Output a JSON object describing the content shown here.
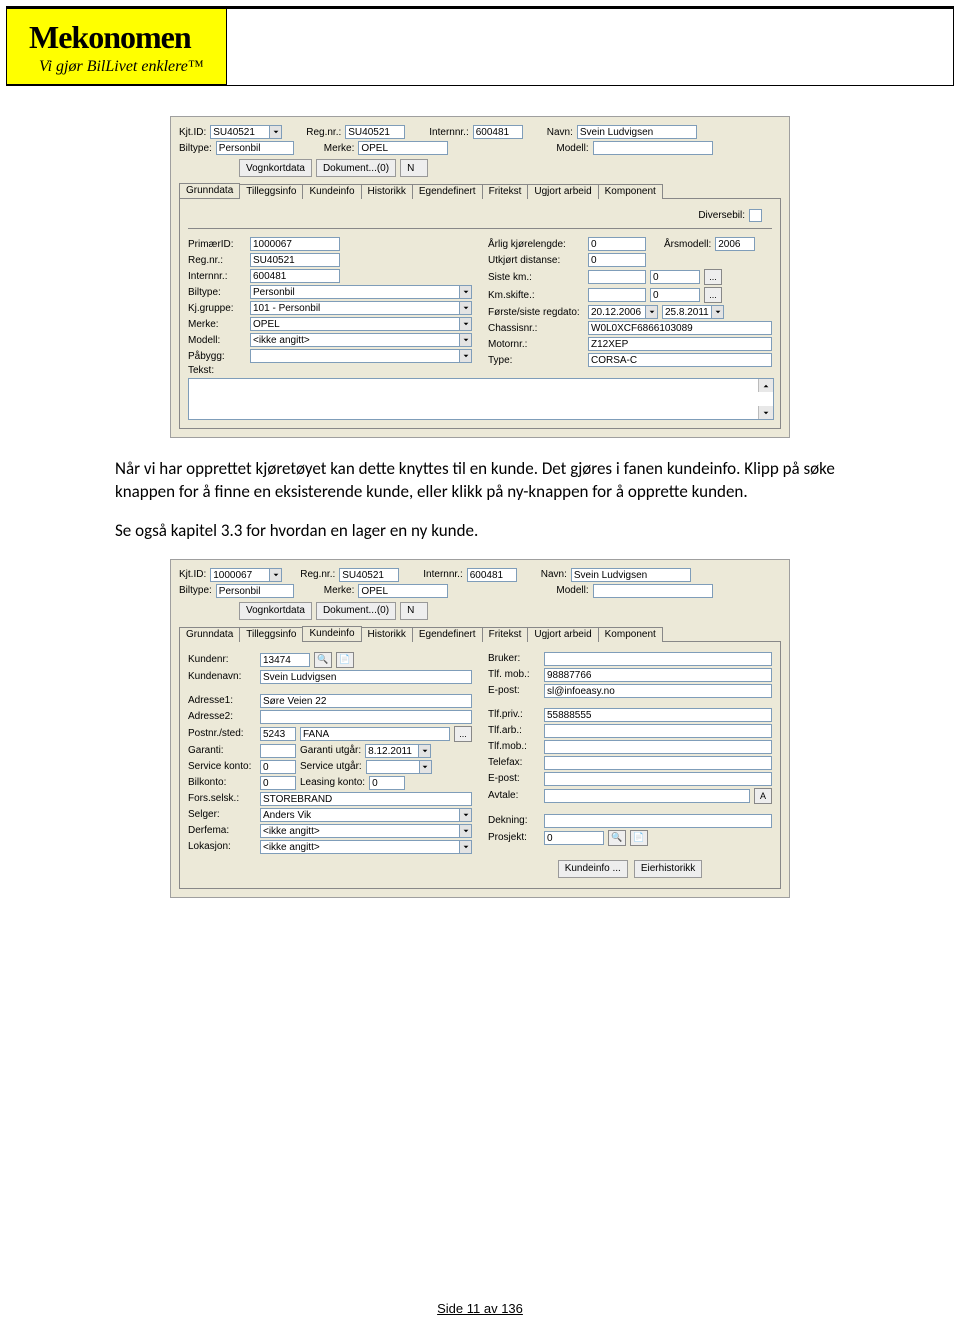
{
  "header": {
    "brand": "Mekonomen",
    "tagline": "Vi gjør BilLivet enklere™"
  },
  "screenshot1": {
    "top": {
      "kjtid_label": "Kjt.ID:",
      "kjtid": "SU40521",
      "regnr_label": "Reg.nr.:",
      "regnr": "SU40521",
      "internnr_label": "Internnr.:",
      "internnr": "600481",
      "navn_label": "Navn:",
      "navn": "Svein Ludvigsen",
      "biltype_label": "Biltype:",
      "biltype": "Personbil",
      "merke_label": "Merke:",
      "merke": "OPEL",
      "modell_label": "Modell:",
      "modell": "",
      "btn_vognkort": "Vognkortdata",
      "btn_dokument": "Dokument...(0)",
      "btn_n": "N"
    },
    "tabs": [
      "Grunndata",
      "Tilleggsinfo",
      "Kundeinfo",
      "Historikk",
      "Egendefinert",
      "Fritekst",
      "Ugjort arbeid",
      "Komponent"
    ],
    "active_tab": 0,
    "diversebil_label": "Diversebil:",
    "left": {
      "primaerid_label": "PrimærID:",
      "primaerid": "1000067",
      "regnr_label": "Reg.nr.:",
      "regnr": "SU40521",
      "internnr_label": "Internnr.:",
      "internnr": "600481",
      "biltype_label": "Biltype:",
      "biltype": "Personbil",
      "kjgruppe_label": "Kj.gruppe:",
      "kjgruppe": "101 - Personbil",
      "merke_label": "Merke:",
      "merke": "OPEL",
      "modell_label": "Modell:",
      "modell": "<ikke angitt>",
      "pabygg_label": "Påbygg:",
      "pabygg": "",
      "tekst_label": "Tekst:"
    },
    "right": {
      "arligkjl_label": "Årlig kjørelengde:",
      "arligkjl": "0",
      "arsmodell_label": "Årsmodell:",
      "arsmodell": "2006",
      "utkjort_label": "Utkjørt distanse:",
      "utkjort": "0",
      "sistekm_label": "Siste km.:",
      "sistekm_a": "",
      "sistekm_b": "0",
      "kmskifte_label": "Km.skifte.:",
      "kmskifte_a": "",
      "kmskifte_b": "0",
      "regdato_label": "Første/siste regdato:",
      "regdato_a": "20.12.2006",
      "regdato_b": "25.8.2011",
      "chassis_label": "Chassisnr.:",
      "chassis": "W0L0XCF6866103089",
      "motornr_label": "Motornr.:",
      "motornr": "Z12XEP",
      "type_label": "Type:",
      "type": "CORSA-C"
    }
  },
  "body": {
    "p1": "Når vi har opprettet kjøretøyet kan dette knyttes til en kunde. Det gjøres i fanen kundeinfo. Klipp på søke knappen for å finne en eksisterende kunde, eller klikk på ny-knappen for å opprette kunden.",
    "p2": "Se også kapitel 3.3 for hvordan en lager en ny kunde."
  },
  "screenshot2": {
    "top": {
      "kjtid_label": "Kjt.ID:",
      "kjtid": "1000067",
      "regnr_label": "Reg.nr.:",
      "regnr": "SU40521",
      "internnr_label": "Internnr.:",
      "internnr": "600481",
      "navn_label": "Navn:",
      "navn": "Svein Ludvigsen",
      "biltype_label": "Biltype:",
      "biltype": "Personbil",
      "merke_label": "Merke:",
      "merke": "OPEL",
      "modell_label": "Modell:",
      "modell": "",
      "btn_vognkort": "Vognkortdata",
      "btn_dokument": "Dokument...(0)",
      "btn_n": "N"
    },
    "tabs": [
      "Grunndata",
      "Tilleggsinfo",
      "Kundeinfo",
      "Historikk",
      "Egendefinert",
      "Fritekst",
      "Ugjort arbeid",
      "Komponent"
    ],
    "active_tab": 2,
    "left": {
      "kundenr_label": "Kundenr:",
      "kundenr": "13474",
      "kundenavn_label": "Kundenavn:",
      "kundenavn": "Svein Ludvigsen",
      "adresse1_label": "Adresse1:",
      "adresse1": "Søre Veien 22",
      "adresse2_label": "Adresse2:",
      "adresse2": "",
      "postnr_label": "Postnr./sted:",
      "postnr": "5243",
      "poststed": "FANA",
      "garanti_label": "Garanti:",
      "garanti": "",
      "garanti_utgar_label": "Garanti utgår:",
      "garanti_utgar": "8.12.2011",
      "servicekonto_label": "Service konto:",
      "servicekonto": "0",
      "service_utgar_label": "Service utgår:",
      "service_utgar": "",
      "bilkonto_label": "Bilkonto:",
      "bilkonto": "0",
      "leasingkonto_label": "Leasing konto:",
      "leasingkonto": "0",
      "forsselsk_label": "Fors.selsk.:",
      "forsselsk": "STOREBRAND",
      "selger_label": "Selger:",
      "selger": "Anders Vik",
      "derfema_label": "Derfema:",
      "derfema": "<ikke angitt>",
      "lokasjon_label": "Lokasjon:",
      "lokasjon": "<ikke angitt>"
    },
    "right": {
      "bruker_label": "Bruker:",
      "bruker": "",
      "tlfmob_label": "Tlf. mob.:",
      "tlfmob": "98887766",
      "epost_label": "E-post:",
      "epost": "sl@infoeasy.no",
      "tlfpriv_label": "Tlf.priv.:",
      "tlfpriv": "55888555",
      "tlfarb_label": "Tlf.arb.:",
      "tlfarb": "",
      "tlfmob2_label": "Tlf.mob.:",
      "tlfmob2": "",
      "telefax_label": "Telefax:",
      "telefax": "",
      "epost2_label": "E-post:",
      "epost2": "",
      "avtale_label": "Avtale:",
      "avtale": "",
      "avtale_btn": "A",
      "dekning_label": "Dekning:",
      "dekning": "",
      "prosjekt_label": "Prosjekt:",
      "prosjekt": "0",
      "btn_kundeinfo": "Kundeinfo ...",
      "btn_eierhistorikk": "Eierhistorikk"
    }
  },
  "footer": "Side 11 av 136"
}
